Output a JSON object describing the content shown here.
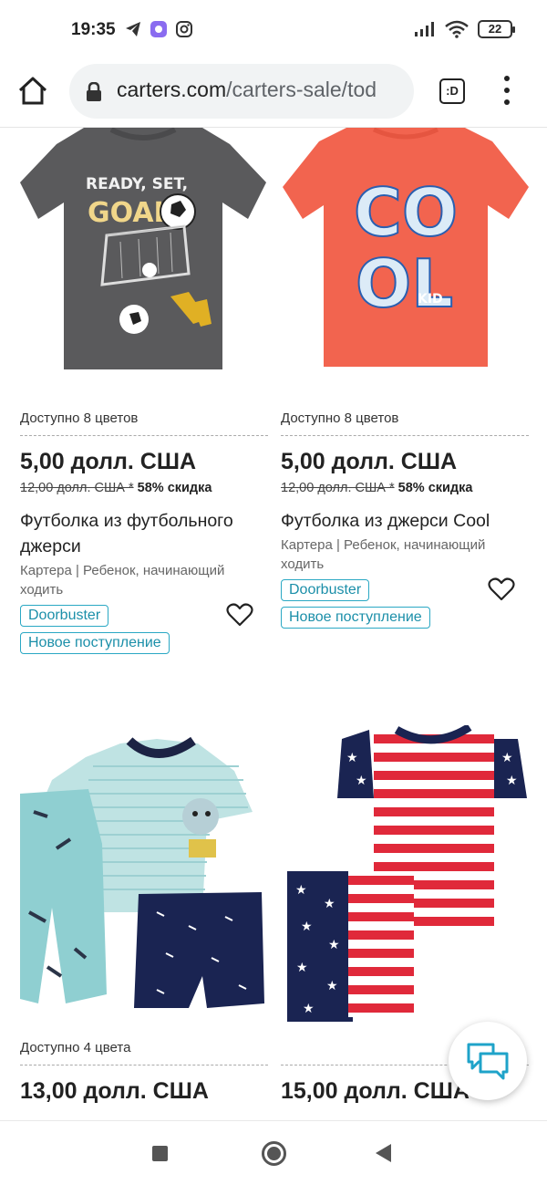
{
  "status_bar": {
    "time": "19:35",
    "battery": "22",
    "left_icons": [
      "telegram-icon",
      "app-icon",
      "instagram-icon"
    ],
    "right_icons": [
      "signal-icon",
      "wifi-icon",
      "battery-icon"
    ]
  },
  "browser": {
    "url_domain": "carters.com",
    "url_path": "/carters-sale/tod",
    "tab_indicator": ":D"
  },
  "products": [
    {
      "colors": "Доступно 8 цветов",
      "price": "5,00 долл. США",
      "old_price": "12,00 долл. США *",
      "discount": "58% скидка",
      "title": "Футболка из футбольного джерси",
      "subtitle": "Картера | Ребенок, начинающий ходить",
      "badges": [
        "Doorbuster",
        "Новое поступление"
      ],
      "image": "gray-soccer-tshirt",
      "image_text": [
        "READY, SET,",
        "GOAL!"
      ]
    },
    {
      "colors": "Доступно 8 цветов",
      "price": "5,00 долл. США",
      "old_price": "12,00 долл. США *",
      "discount": "58% скидка",
      "title": "Футболка из джерси Cool",
      "subtitle": "Картера | Ребенок, начинающий ходить",
      "badges": [
        "Doorbuster",
        "Новое поступление"
      ],
      "image": "coral-cool-kid-tshirt",
      "image_text": [
        "CO",
        "OL",
        "KID"
      ]
    },
    {
      "colors": "Доступно 4 цвета",
      "price": "13,00 долл. США",
      "image": "dog-pajama-set"
    },
    {
      "price": "15,00 долл. США",
      "image": "stars-and-stripes-pajama-set"
    }
  ],
  "colors": {
    "badge_accent": "#2aa8c4",
    "chat_icon": "#1fa3c9",
    "shirt_gray": "#5a5a5c",
    "shirt_coral": "#f2644f"
  }
}
